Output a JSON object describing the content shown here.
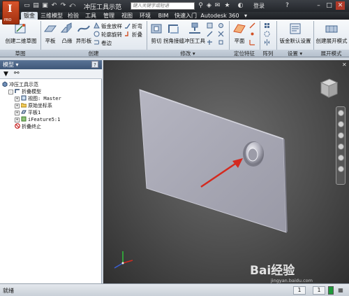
{
  "titlebar": {
    "logo_letter": "I",
    "logo_sub": "PRO",
    "doc_title": "冲压工具示范",
    "search_placeholder": "键入关键字或短语",
    "login_label": "登录"
  },
  "menu_tabs": [
    "钣金",
    "三维模型",
    "检验",
    "工具",
    "管理",
    "视图",
    "环境",
    "BIM",
    "快速入门",
    "Autodesk 360"
  ],
  "ribbon": {
    "panels": [
      {
        "label": "草图"
      },
      {
        "label": "创建"
      },
      {
        "label": "修改",
        "has_dropdown": true
      },
      {
        "label": "定位特征"
      },
      {
        "label": "阵列"
      },
      {
        "label": "设置",
        "has_dropdown": true
      },
      {
        "label": "展开模式"
      }
    ],
    "sketch_button": "创建二维草图",
    "create_big": [
      "平板",
      "凸缘",
      "异形板"
    ],
    "create_small": [
      "钣金放样",
      "轮廓旋转",
      "卷边",
      "折弯",
      "折叠"
    ],
    "modify_buttons": [
      "剪切",
      "拐角接缝",
      "冲压工具"
    ],
    "plane_button": "平面",
    "settings_button": "钣金默认设置",
    "flat_button": "创建展开模式"
  },
  "browser": {
    "title": "模型",
    "tree": [
      {
        "label": "冲压工具示范",
        "indent": 0,
        "icon": "part-icon",
        "expander": ""
      },
      {
        "label": "折叠模型",
        "indent": 1,
        "icon": "folded-model-icon",
        "expander": "-"
      },
      {
        "label": "视图: Master",
        "indent": 2,
        "icon": "view-icon",
        "expander": "+"
      },
      {
        "label": "原始坐标系",
        "indent": 2,
        "icon": "folder-icon",
        "expander": "+"
      },
      {
        "label": "平板1",
        "indent": 2,
        "icon": "face-icon",
        "expander": "+"
      },
      {
        "label": "iFeature5:1",
        "indent": 2,
        "icon": "ifeature-icon",
        "expander": "+"
      },
      {
        "label": "折叠终止",
        "indent": 2,
        "icon": "end-of-folded-icon",
        "expander": ""
      }
    ]
  },
  "status": {
    "text": "就绪",
    "num1": "1",
    "num2": "1"
  },
  "watermark": {
    "logo": "Bai经验",
    "sub": "jingyan.baidu.com"
  },
  "colors": {
    "accent": "#d25024",
    "annotation_arrow": "#d42a1f",
    "plate": "#a8a8b4"
  }
}
